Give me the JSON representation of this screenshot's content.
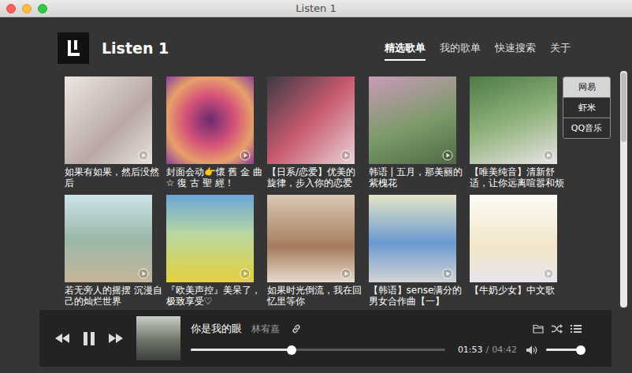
{
  "window": {
    "title": "Listen 1"
  },
  "brand": {
    "name": "Listen 1"
  },
  "nav": [
    {
      "label": "精选歌单",
      "selected": true
    },
    {
      "label": "我的歌单",
      "selected": false
    },
    {
      "label": "快速搜索",
      "selected": false
    },
    {
      "label": "关于",
      "selected": false
    }
  ],
  "sources": [
    {
      "label": "网易",
      "selected": true
    },
    {
      "label": "虾米",
      "selected": false
    },
    {
      "label": "QQ音乐",
      "selected": false
    }
  ],
  "playlists": [
    {
      "title": "如果有如果，然后没然后"
    },
    {
      "title": "封面会动👉懷 舊 金 曲☆ 復 古 聖 經！"
    },
    {
      "title": "【日系/恋爱】优美的旋律，步入你的恋爱"
    },
    {
      "title": "韩语 | 五月，那美丽的紫槐花"
    },
    {
      "title": "【唯美纯音】清新舒适，让你远离喧嚣和烦"
    },
    {
      "title": "若无旁人的摇摆 沉漫自己的灿烂世界"
    },
    {
      "title": "『欧美声控』美呆了，极致享受♡"
    },
    {
      "title": "如果时光倒流，我在回忆里等你"
    },
    {
      "title": "【韩语】sense满分的男女合作曲【一】"
    },
    {
      "title": "【牛奶少女】中文歌"
    }
  ],
  "player": {
    "playing": true,
    "title": "你是我的眼",
    "artist": "林宥嘉",
    "progress": {
      "level": 0.396
    },
    "time": {
      "current": "01:53",
      "separator": "/",
      "total": "04:42"
    },
    "volume": {
      "level": 0.97
    }
  }
}
